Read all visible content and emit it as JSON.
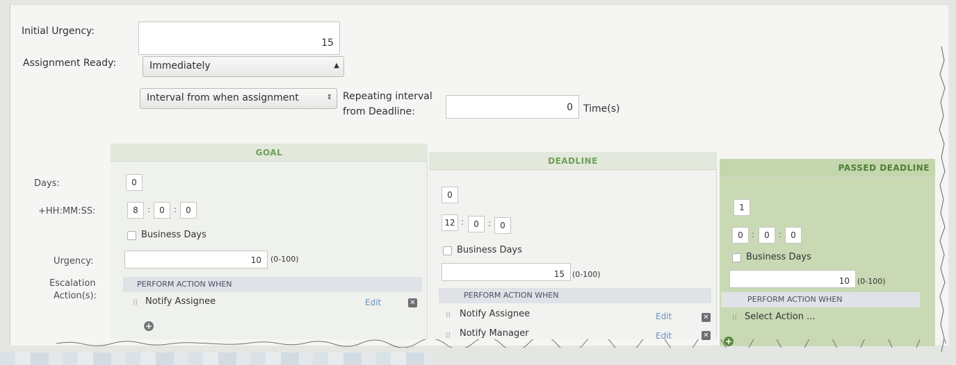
{
  "form": {
    "initial_urgency_label": "Initial Urgency:",
    "initial_urgency_value": "15",
    "assignment_ready_label": "Assignment Ready:",
    "assignment_ready_value": "Immediately",
    "interval_select_value": "Interval from when assignment",
    "repeating_label_line1": "Repeating interval",
    "repeating_label_line2": "from Deadline:",
    "repeating_value": "0",
    "repeating_unit": "Time(s)"
  },
  "row_labels": {
    "days": "Days:",
    "hhmmss": "+HH:MM:SS:",
    "urgency": "Urgency:",
    "escalation_line1": "Escalation",
    "escalation_line2": "Action(s):"
  },
  "goal": {
    "header": "GOAL",
    "days": "0",
    "hh": "8",
    "mm": "0",
    "ss": "0",
    "business_days_label": "Business Days",
    "urgency": "10",
    "urgency_range": "(0-100)",
    "actions_header": "PERFORM ACTION  WHEN",
    "actions": [
      {
        "label": "Notify Assignee",
        "edit": "Edit"
      }
    ]
  },
  "deadline": {
    "header": "DEADLINE",
    "days": "0",
    "hh": "12",
    "mm": "0",
    "ss": "0",
    "business_days_label": "Business Days",
    "urgency": "15",
    "urgency_range": "(0-100)",
    "actions_header": "PERFORM ACTION  WHEN",
    "actions": [
      {
        "label": "Notify Assignee",
        "edit": "Edit"
      },
      {
        "label": "Notify Manager",
        "edit": "Edit"
      }
    ]
  },
  "passed_deadline": {
    "header": "PASSED DEADLINE",
    "days": "1",
    "hh": "0",
    "mm": "0",
    "ss": "0",
    "business_days_label": "Business Days",
    "urgency": "10",
    "urgency_range": "(0-100)",
    "actions_header": "PERFORM ACTION  WHEN",
    "actions": [
      {
        "label": "Select Action ..."
      }
    ]
  },
  "icons": {
    "select_arrow": "updown-caret-icon",
    "remove": "close-icon",
    "add": "plus-circle-icon",
    "drag": "drag-handle-icon"
  },
  "colors": {
    "header_green": "#6f9f58",
    "passed_panel": "#c8d9b4",
    "edit_link": "#6a8fbf"
  }
}
